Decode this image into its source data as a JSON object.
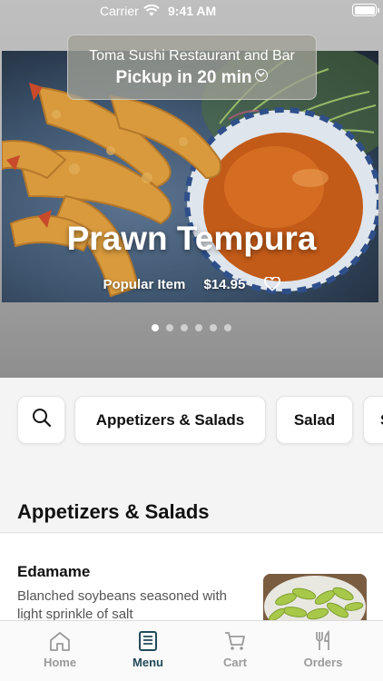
{
  "status_bar": {
    "carrier": "Carrier",
    "time": "9:41 AM"
  },
  "restaurant": {
    "name": "Toma Sushi Restaurant and Bar",
    "pickup": "Pickup in 20 min"
  },
  "featured": {
    "title": "Prawn Tempura",
    "tag": "Popular Item",
    "price": "$14.95",
    "page_count": 6,
    "active_page": 1
  },
  "categories": [
    "Appetizers & Salads",
    "Salad",
    "S"
  ],
  "section": {
    "title": "Appetizers & Salads"
  },
  "items": [
    {
      "name": "Edamame",
      "description": "Blanched soybeans seasoned with light sprinkle of salt"
    }
  ],
  "tabs": [
    {
      "label": "Home",
      "icon": "home-icon",
      "active": false
    },
    {
      "label": "Menu",
      "icon": "menu-book-icon",
      "active": true
    },
    {
      "label": "Cart",
      "icon": "cart-icon",
      "active": false
    },
    {
      "label": "Orders",
      "icon": "fork-knife-icon",
      "active": false
    }
  ],
  "colors": {
    "accent": "#234a5a",
    "inactive_tab": "#9a9a9a"
  }
}
